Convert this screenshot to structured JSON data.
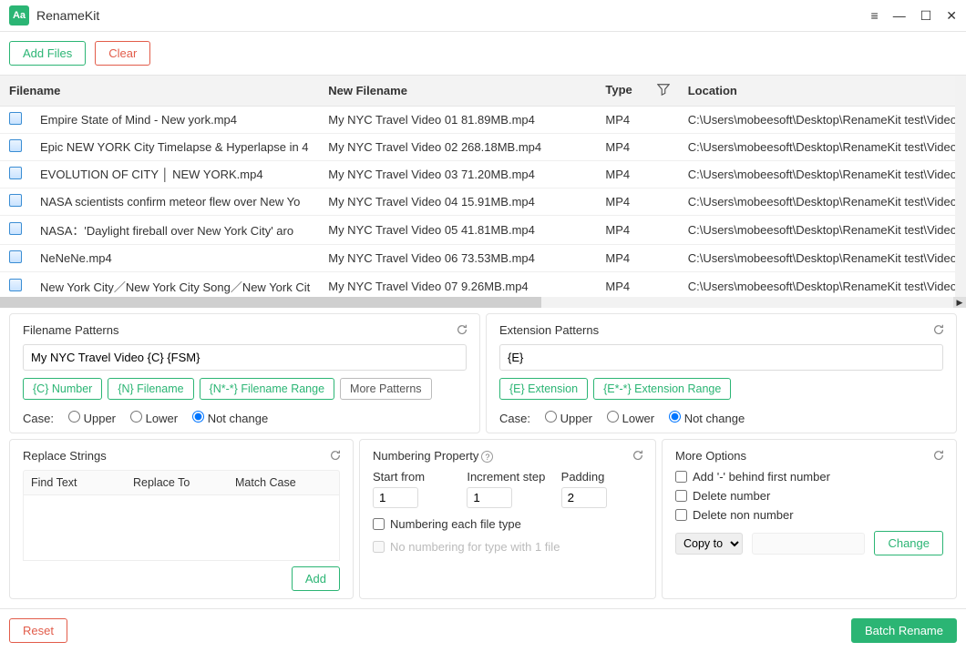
{
  "app": {
    "title": "RenameKit"
  },
  "toolbar": {
    "add_files": "Add Files",
    "clear": "Clear"
  },
  "table": {
    "headers": {
      "filename": "Filename",
      "newname": "New Filename",
      "type": "Type",
      "location": "Location"
    },
    "rows": [
      {
        "filename": "Empire State of Mind - New york.mp4",
        "newname": "My NYC Travel Video 01 81.89MB.mp4",
        "type": "MP4",
        "location": "C:\\Users\\mobeesoft\\Desktop\\RenameKit test\\Video"
      },
      {
        "filename": "Epic NEW YORK City Timelapse & Hyperlapse in 4",
        "newname": "My NYC Travel Video 02 268.18MB.mp4",
        "type": "MP4",
        "location": "C:\\Users\\mobeesoft\\Desktop\\RenameKit test\\Video"
      },
      {
        "filename": "EVOLUTION OF CITY │ NEW YORK.mp4",
        "newname": "My NYC Travel Video 03 71.20MB.mp4",
        "type": "MP4",
        "location": "C:\\Users\\mobeesoft\\Desktop\\RenameKit test\\Video"
      },
      {
        "filename": "NASA scientists confirm meteor flew over New Yo",
        "newname": "My NYC Travel Video 04 15.91MB.mp4",
        "type": "MP4",
        "location": "C:\\Users\\mobeesoft\\Desktop\\RenameKit test\\Video"
      },
      {
        "filename": "NASA：'Daylight fireball over New York City' aro",
        "newname": "My NYC Travel Video 05 41.81MB.mp4",
        "type": "MP4",
        "location": "C:\\Users\\mobeesoft\\Desktop\\RenameKit test\\Video"
      },
      {
        "filename": "NeNeNe.mp4",
        "newname": "My NYC Travel Video 06 73.53MB.mp4",
        "type": "MP4",
        "location": "C:\\Users\\mobeesoft\\Desktop\\RenameKit test\\Video"
      },
      {
        "filename": "New York City／New York City Song／New York Cit",
        "newname": "My NYC Travel Video 07 9.26MB.mp4",
        "type": "MP4",
        "location": "C:\\Users\\mobeesoft\\Desktop\\RenameKit test\\Video"
      }
    ]
  },
  "filename_patterns": {
    "title": "Filename Patterns",
    "value": "My NYC Travel Video {C} {FSM}",
    "chips": {
      "c": "{C} Number",
      "n": "{N} Filename",
      "nr": "{N*-*} Filename Range",
      "more": "More Patterns"
    },
    "case_label": "Case:",
    "upper": "Upper",
    "lower": "Lower",
    "notchange": "Not change"
  },
  "extension_patterns": {
    "title": "Extension Patterns",
    "value": "{E}",
    "chips": {
      "e": "{E} Extension",
      "er": "{E*-*} Extension Range"
    },
    "case_label": "Case:",
    "upper": "Upper",
    "lower": "Lower",
    "notchange": "Not change"
  },
  "replace": {
    "title": "Replace Strings",
    "cols": {
      "find": "Find Text",
      "to": "Replace To",
      "match": "Match Case"
    },
    "add": "Add"
  },
  "numbering": {
    "title": "Numbering Property",
    "start_label": "Start from",
    "start": "1",
    "step_label": "Increment step",
    "step": "1",
    "pad_label": "Padding",
    "pad": "2",
    "each_type": "Numbering each file type",
    "no_num_single": "No numbering for type with 1 file"
  },
  "more": {
    "title": "More Options",
    "dash": "Add '-' behind first number",
    "delnum": "Delete number",
    "delnon": "Delete non number",
    "copyto_label": "Copy to",
    "change": "Change"
  },
  "footer": {
    "reset": "Reset",
    "batch": "Batch Rename"
  }
}
